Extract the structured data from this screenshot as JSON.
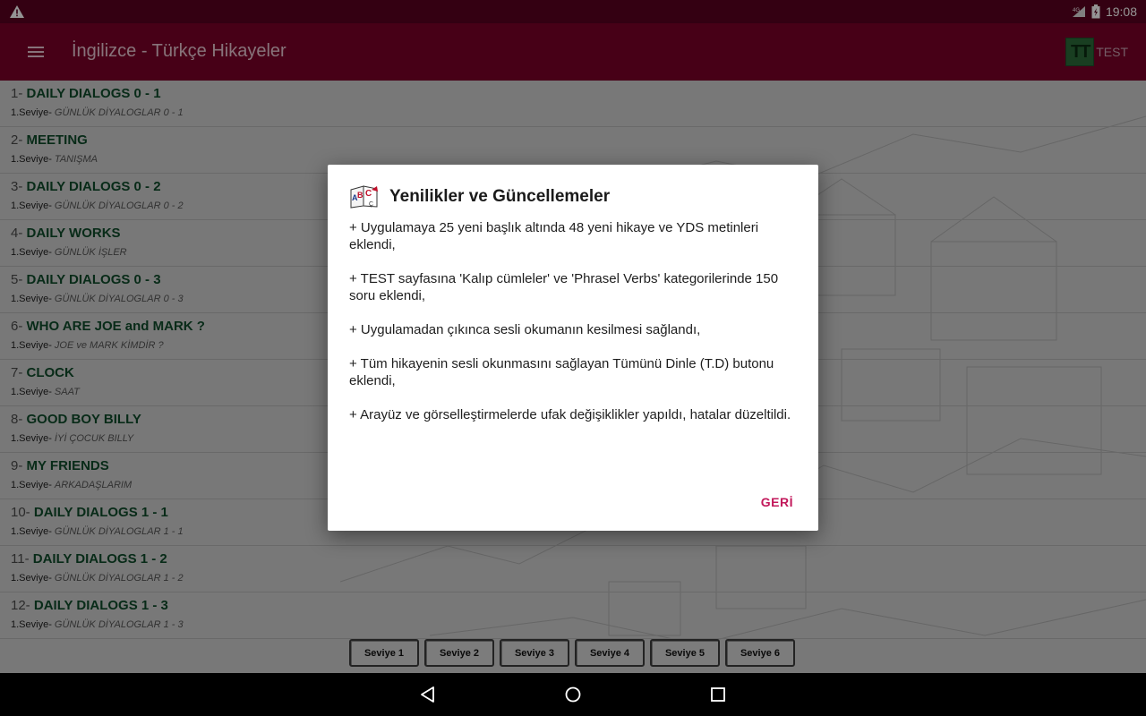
{
  "status_bar": {
    "time": "19:08",
    "network": "4G"
  },
  "app_bar": {
    "title": "İngilizce - Türkçe Hikayeler",
    "test_logo": "TT",
    "test_label": "TEST"
  },
  "stories": [
    {
      "num": "1- ",
      "title": "DAILY DIALOGS 0 - 1",
      "level": "1.Seviye- ",
      "tr": "GÜNLÜK DİYALOGLAR 0 - 1"
    },
    {
      "num": "2- ",
      "title": "MEETING",
      "level": "1.Seviye- ",
      "tr": "TANIŞMA"
    },
    {
      "num": "3- ",
      "title": "DAILY DIALOGS 0 - 2",
      "level": "1.Seviye- ",
      "tr": "GÜNLÜK DİYALOGLAR 0 - 2"
    },
    {
      "num": "4- ",
      "title": "DAILY WORKS",
      "level": "1.Seviye- ",
      "tr": "GÜNLÜK İŞLER"
    },
    {
      "num": "5- ",
      "title": "DAILY DIALOGS 0 - 3",
      "level": "1.Seviye- ",
      "tr": "GÜNLÜK DİYALOGLAR 0 - 3"
    },
    {
      "num": "6- ",
      "title": "WHO ARE JOE and MARK ?",
      "level": "1.Seviye- ",
      "tr": "JOE ve MARK KİMDİR ?"
    },
    {
      "num": "7- ",
      "title": "CLOCK",
      "level": "1.Seviye- ",
      "tr": "SAAT"
    },
    {
      "num": "8- ",
      "title": "GOOD BOY BILLY",
      "level": "1.Seviye- ",
      "tr": "İYİ ÇOCUK BILLY"
    },
    {
      "num": "9- ",
      "title": "MY FRIENDS",
      "level": "1.Seviye- ",
      "tr": "ARKADAŞLARIM"
    },
    {
      "num": "10- ",
      "title": "DAILY DIALOGS 1 - 1",
      "level": "1.Seviye- ",
      "tr": "GÜNLÜK DİYALOGLAR 1 - 1"
    },
    {
      "num": "11- ",
      "title": "DAILY DIALOGS 1 - 2",
      "level": "1.Seviye- ",
      "tr": "GÜNLÜK DİYALOGLAR 1 - 2"
    },
    {
      "num": "12- ",
      "title": "DAILY DIALOGS 1 - 3",
      "level": "1.Seviye- ",
      "tr": "GÜNLÜK DİYALOGLAR 1 - 3"
    }
  ],
  "levels": [
    "Seviye 1",
    "Seviye 2",
    "Seviye 3",
    "Seviye 4",
    "Seviye 5",
    "Seviye 6"
  ],
  "dialog": {
    "title": "Yenilikler ve Güncellemeler",
    "items": [
      "+ Uygulamaya 25 yeni başlık altında 48 yeni hikaye ve YDS metinleri eklendi,",
      "+ TEST sayfasına 'Kalıp cümleler' ve 'Phrasel Verbs' kategorilerinde 150 soru eklendi,",
      "+ Uygulamadan çıkınca sesli okumanın kesilmesi sağlandı,",
      "+ Tüm hikayenin sesli okunmasını sağlayan Tümünü Dinle (T.D) butonu eklendi,",
      "+ Arayüz ve görselleştirmelerde ufak değişiklikler yapıldı, hatalar düzeltildi."
    ],
    "back_label": "GERİ"
  },
  "colors": {
    "status_bar": "#5a0020",
    "app_bar": "#7a0028",
    "story_title": "#0e4a2a",
    "accent": "#c2185b"
  }
}
